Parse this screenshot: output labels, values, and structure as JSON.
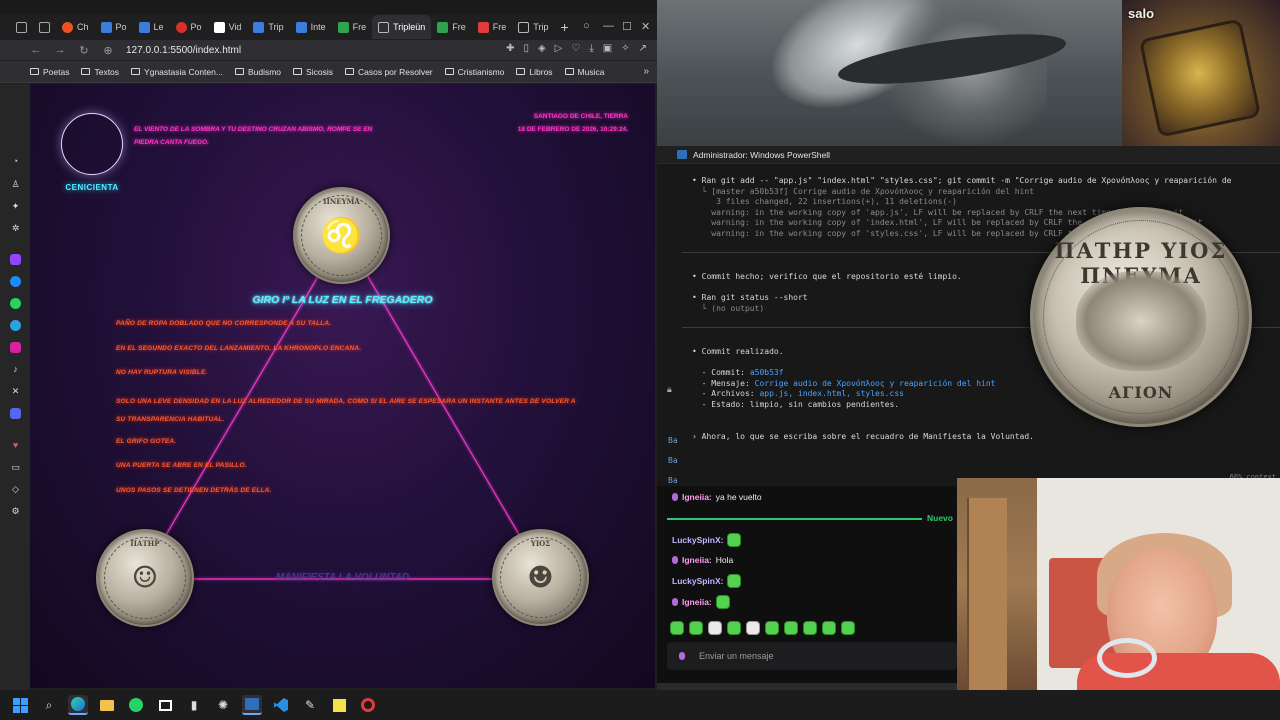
{
  "browser": {
    "tabs": [
      {
        "label": "Ch",
        "color": "#f25022"
      },
      {
        "label": "Po",
        "color": "#3b7ddd"
      },
      {
        "label": "Le",
        "color": "#3b7ddd"
      },
      {
        "label": "Po",
        "color": "#d9302c"
      },
      {
        "label": "Vid",
        "color": "#ffffff"
      },
      {
        "label": "Trip",
        "color": "#3b7ddd"
      },
      {
        "label": "Inte",
        "color": "#3b7ddd"
      },
      {
        "label": "Fre",
        "color": "#2ea44f"
      },
      {
        "label": "Tripleün",
        "color": "#777777"
      },
      {
        "label": "Fre",
        "color": "#2ea44f"
      },
      {
        "label": "Fre",
        "color": "#e23b3b"
      },
      {
        "label": "Trip",
        "color": "#777777"
      }
    ],
    "url": "127.0.0.1:5500/index.html",
    "bookmarks": [
      "Poetas",
      "Textos",
      "Ygnastasia Conten...",
      "Budismo",
      "Sicosis",
      "Casos por Resolver",
      "Cristianismo",
      "Libros",
      "Musica"
    ]
  },
  "webpage": {
    "avatar_name": "CENICIENTA",
    "quote": "EL VIENTO DE LA SOMBRA Y TU DESTINO CRUZAN ABISMO, ROMPE SE EN PIEDRA CANTA FUEGO.",
    "location": "SANTIAGO DE CHILE, TIERRA",
    "datetime": "18 DE FEBRERO DE 2026, 10:29:24.",
    "title": "GIRO Iº LA LUZ EN EL FREGADERO",
    "lines": [
      "PAÑO DE ROPA DOBLADO QUE NO CORRESPONDE A SU TALLA.",
      "EN EL SEGUNDO EXACTO DEL LANZAMIENTO, LA KHRONOPLO ENCANA.",
      "NO HAY RUPTURA VISIBLE.",
      "SOLO UNA LEVE DENSIDAD EN LA LUZ ALREDEDOR DE SU MIRADA, COMO SI EL AIRE SE ESPESARA UN INSTANTE ANTES DE VOLVER A SU TRANSPARENCIA HABITUAL.",
      "EL GRIFO GOTEA.",
      "UNA PUERTA SE ABRE EN EL PASILLO.",
      "UNOS PASOS SE DETIENEN DETRÁS DE ELLA."
    ],
    "manifiesta": "MANIFIESTA LA VOLUNTAD",
    "coins": {
      "top_legend_left": "ΠΝΕΥΜΑ",
      "left_legend": "ΠΑΤΗΡ",
      "right_legend": "ΥΙΟΣ"
    }
  },
  "powershell": {
    "title": "Administrador: Windows PowerShell",
    "lines": {
      "ran_git_add": "Ran git add -- \"app.js\" \"index.html\" \"styles.css\"; git commit -m \"Corrige audio de Χρονόπλοος y reaparición de",
      "commit_line": "[master a50b53f] Corrige audio de Χρονόπλοος y reaparición del hint",
      "files_changed": "3 files changed, 22 insertions(+), 11 deletions(-)",
      "warn1": "warning: in the working copy of 'app.js', LF will be replaced by CRLF the next time Git touches it",
      "warn2": "warning: in the working copy of 'index.html', LF will be replaced by CRLF the next time Git touches it",
      "warn3": "warning: in the working copy of 'styles.css', LF will be replaced by CRLF the next time Git touches it",
      "commit_hecho": "Commit hecho; verifico que el repositorio esté limpio.",
      "ran_status": "Ran git status --short",
      "no_output": "(no output)",
      "commit_realizado": "Commit realizado.",
      "commit_label": "- Commit:",
      "commit_hash": "a50b53f",
      "mensaje_label": "- Mensaje:",
      "mensaje_val": "Corrige audio de Χρονόπλοος y reaparición del hint",
      "archivos_label": "- Archivos:",
      "archivos_val": "app.js, index.html, styles.css",
      "estado": "- Estado: limpio, sin cambios pendientes.",
      "ahora": "Ahora, lo que se escriba sobre el recuadro de Manifiesta la Voluntad.",
      "context": "66% context"
    },
    "big_coin_top": "ΠΑΤΗΡ ΥΙΟΣ ΠΝΕΥΜΑ",
    "big_coin_bottom": "ΑΓΙΟΝ"
  },
  "overlay": {
    "salo_label": "salo"
  },
  "chat": {
    "messages": [
      {
        "user": "Igneiia:",
        "text": "ya he vuelto",
        "mic": true
      },
      {
        "user": "LuckySpinX:",
        "text": "",
        "mic": false
      },
      {
        "user": "Igneiia:",
        "text": "Hola",
        "mic": true
      },
      {
        "user": "LuckySpinX:",
        "text": "",
        "mic": false
      },
      {
        "user": "Igneiia:",
        "text": "",
        "mic": true
      }
    ],
    "new_label": "Nuevo",
    "input_placeholder": "Enviar un mensaje"
  }
}
